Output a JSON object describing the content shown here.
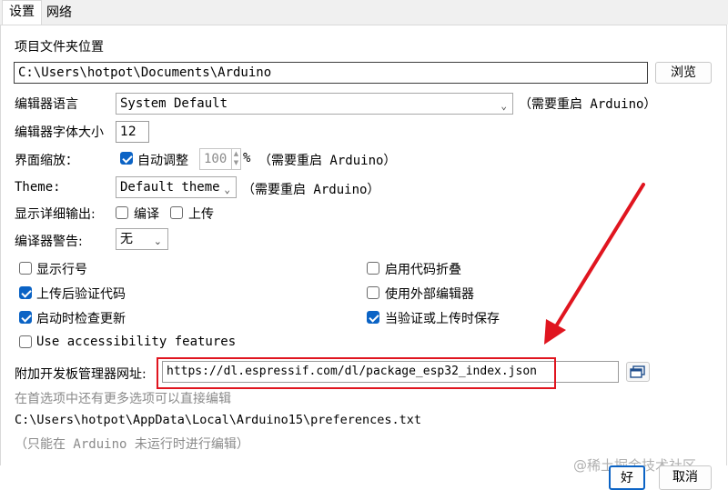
{
  "tabs": [
    "设置",
    "网络"
  ],
  "sketchbook": {
    "label": "项目文件夹位置",
    "path": "C:\\Users\\hotpot\\Documents\\Arduino",
    "browse": "浏览"
  },
  "editor_language": {
    "label": "编辑器语言",
    "value": "System Default",
    "note": "（需要重启 Arduino）"
  },
  "font_size": {
    "label": "编辑器字体大小",
    "value": "12"
  },
  "scale": {
    "label": "界面缩放：",
    "auto_label": "自动调整",
    "auto_checked": true,
    "value": "100",
    "unit": "%",
    "note": "（需要重启 Arduino）"
  },
  "theme": {
    "label": "Theme:",
    "value": "Default theme",
    "note": "（需要重启 Arduino）"
  },
  "verbose": {
    "label": "显示详细输出:",
    "compile": "编译",
    "compile_checked": false,
    "upload": "上传",
    "upload_checked": false
  },
  "warnings": {
    "label": "编译器警告:",
    "value": "无"
  },
  "options": {
    "line_numbers": {
      "label": "显示行号",
      "checked": false
    },
    "code_folding": {
      "label": "启用代码折叠",
      "checked": false
    },
    "verify_upload": {
      "label": "上传后验证代码",
      "checked": true
    },
    "external_editor": {
      "label": "使用外部编辑器",
      "checked": false
    },
    "check_updates": {
      "label": "启动时检查更新",
      "checked": true
    },
    "save_on_verify": {
      "label": "当验证或上传时保存",
      "checked": true
    },
    "accessibility": {
      "label": "Use accessibility features",
      "checked": false
    }
  },
  "board_manager": {
    "label": "附加开发板管理器网址:",
    "url": "https://dl.espressif.com/dl/package_esp32_index.json"
  },
  "more_prefs": "在首选项中还有更多选项可以直接编辑",
  "prefs_path": "C:\\Users\\hotpot\\AppData\\Local\\Arduino15\\preferences.txt",
  "edit_hint": "（只能在 Arduino 未运行时进行编辑）",
  "watermark": "@稀土掘金技术社区",
  "buttons": {
    "ok": "好",
    "cancel": "取消"
  },
  "colors": {
    "accent": "#0b63c5",
    "annotation": "#e0151f"
  }
}
